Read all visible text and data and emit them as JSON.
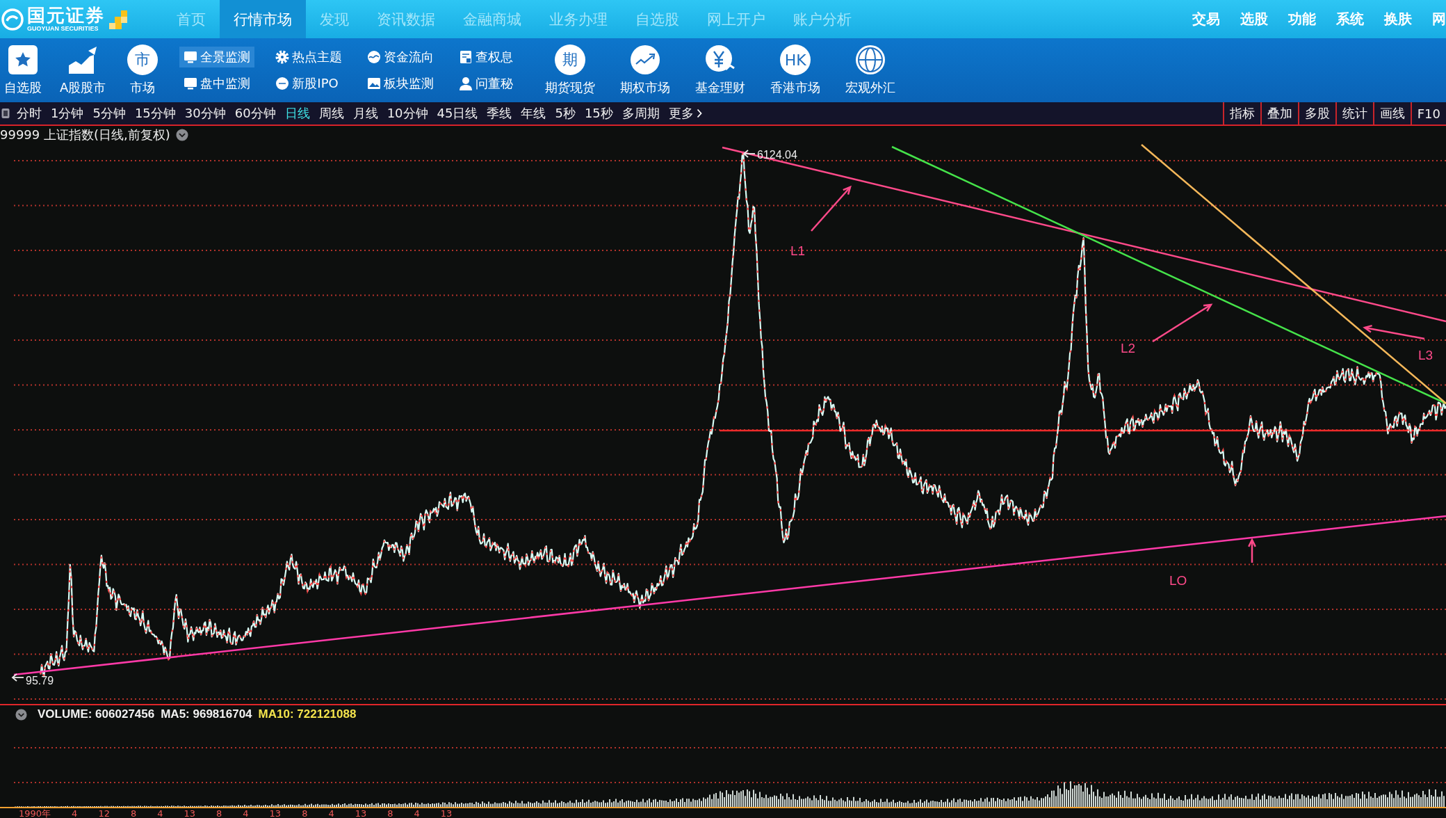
{
  "top_nav": {
    "logo": {
      "name": "国元证券",
      "subtitle": "GUOYUAN SECURITIES"
    },
    "tabs": [
      {
        "label": "首页",
        "selected": false
      },
      {
        "label": "行情市场",
        "selected": true
      },
      {
        "label": "发现",
        "selected": false
      },
      {
        "label": "资讯数据",
        "selected": false
      },
      {
        "label": "金融商城",
        "selected": false
      },
      {
        "label": "业务办理",
        "selected": false
      },
      {
        "label": "自选股",
        "selected": false
      },
      {
        "label": "网上开户",
        "selected": false
      },
      {
        "label": "账户分析",
        "selected": false
      }
    ],
    "menu": [
      "交易",
      "选股",
      "功能",
      "系统",
      "换肤",
      "网"
    ]
  },
  "toolbar": {
    "items": [
      {
        "kind": "icon",
        "label": "自选股"
      },
      {
        "kind": "icon",
        "label": "A股股市"
      },
      {
        "kind": "glyph",
        "glyph": "市",
        "label": "市场"
      },
      {
        "kind": "pair",
        "entries": [
          {
            "label": "全景监测",
            "selected": true
          },
          {
            "label": "盘中监测",
            "selected": false
          }
        ]
      },
      {
        "kind": "pair",
        "entries": [
          {
            "label": "热点主题",
            "selected": false
          },
          {
            "label": "新股IPO",
            "selected": false
          }
        ]
      },
      {
        "kind": "pair",
        "entries": [
          {
            "label": "资金流向",
            "selected": false
          },
          {
            "label": "板块监测",
            "selected": false
          }
        ]
      },
      {
        "kind": "pair",
        "entries": [
          {
            "label": "查权息",
            "selected": false
          },
          {
            "label": "问董秘",
            "selected": false
          }
        ]
      },
      {
        "kind": "glyph",
        "glyph": "期",
        "label": "期货现货"
      },
      {
        "kind": "icon",
        "label": "期权市场"
      },
      {
        "kind": "icon",
        "label": "基金理财"
      },
      {
        "kind": "glyph",
        "glyph": "HK",
        "label": "香港市场"
      },
      {
        "kind": "icon",
        "label": "宏观外汇"
      }
    ]
  },
  "period_bar": {
    "periods": [
      {
        "label": "分时",
        "selected": false
      },
      {
        "label": "1分钟",
        "selected": false
      },
      {
        "label": "5分钟",
        "selected": false
      },
      {
        "label": "15分钟",
        "selected": false
      },
      {
        "label": "30分钟",
        "selected": false
      },
      {
        "label": "60分钟",
        "selected": false
      },
      {
        "label": "日线",
        "selected": true
      },
      {
        "label": "周线",
        "selected": false
      },
      {
        "label": "月线",
        "selected": false
      },
      {
        "label": "10分钟",
        "selected": false
      },
      {
        "label": "45日线",
        "selected": false
      },
      {
        "label": "季线",
        "selected": false
      },
      {
        "label": "年线",
        "selected": false
      },
      {
        "label": "5秒",
        "selected": false
      },
      {
        "label": "15秒",
        "selected": false
      },
      {
        "label": "多周期",
        "selected": false
      }
    ],
    "more": "更多",
    "tools": [
      "指标",
      "叠加",
      "多股",
      "统计",
      "画线",
      "F10"
    ]
  },
  "chart": {
    "title": "99999 上证指数(日线,前复权)",
    "high_label": "6124.04",
    "low_label": "95.79",
    "trendlines": [
      {
        "label": "L1",
        "color": "#ff4a8a"
      },
      {
        "label": "L2",
        "color": "#45e34a"
      },
      {
        "label": "L3",
        "color": "#f5b85a"
      },
      {
        "label": "LO",
        "color": "#ff3aa8"
      }
    ]
  },
  "volume": {
    "indicators": [
      {
        "text": "VOLUME: 606027456",
        "color": "#f2f2f2"
      },
      {
        "text": "MA5: 969816704",
        "color": "#f2f2f2"
      },
      {
        "text": "MA10: 722121088",
        "color": "#f4e44c"
      }
    ]
  },
  "x_axis": {
    "labels": [
      "1990年",
      "4",
      "12",
      "8",
      "4",
      "13",
      "8",
      "4",
      "13",
      "8",
      "4",
      "13",
      "8",
      "4",
      "13"
    ]
  }
}
